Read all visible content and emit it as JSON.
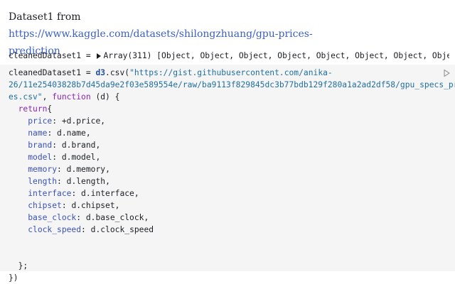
{
  "prose": {
    "prefix": "Dataset1 from ",
    "link_text": "https://www.kaggle.com/datasets/shilongzhuang/gpu-prices-prediction"
  },
  "output": {
    "var_name": "cleanedDataset1",
    "equals": " = ",
    "summary": "Array(311) [Object, Object, Object, Object, Object, Object, Object, Object, O"
  },
  "code": {
    "decl_name": "cleanedDataset1",
    "decl_eq": " = ",
    "lib": "d3",
    "method": ".csv(",
    "url_line1": "\"https://gist.githubusercontent.com/anika-",
    "url_line2": "26/11e25403828b7d45da9e2f03e589554e/raw/ba9113f829845dc3b77bdb129f280a1a2ad2df58/gpu_specs_pric",
    "url_line3": "es.csv\"",
    "after_url": ", ",
    "function_kw": "function",
    "params": " (d) {",
    "return_kw": "return",
    "open_brace": "{",
    "fields": [
      {
        "key": "price",
        "value": "+d.price",
        "comma": ","
      },
      {
        "key": "name",
        "value": "d.name",
        "comma": ","
      },
      {
        "key": "brand",
        "value": "d.brand",
        "comma": ","
      },
      {
        "key": "model",
        "value": "d.model",
        "comma": ","
      },
      {
        "key": "memory",
        "value": "d.memory",
        "comma": ","
      },
      {
        "key": "length",
        "value": "d.length",
        "comma": ","
      },
      {
        "key": "interface",
        "value": "d.interface",
        "comma": ","
      },
      {
        "key": "chipset",
        "value": "d.chipset",
        "comma": ","
      },
      {
        "key": "base_clock",
        "value": "d.base_clock",
        "comma": ","
      },
      {
        "key": "clock_speed",
        "value": "d.clock_speed",
        "comma": ""
      }
    ],
    "close_inner": "};",
    "close_outer": "})"
  },
  "icons": {
    "caret": "disclosure-triangle-icon",
    "run": "play-icon"
  },
  "colors": {
    "link": "#3b5fc0",
    "keyword": "#8a24b5",
    "string": "#1f6fa0",
    "property": "#3a52b6",
    "cell_background": "#f5f5f5"
  }
}
